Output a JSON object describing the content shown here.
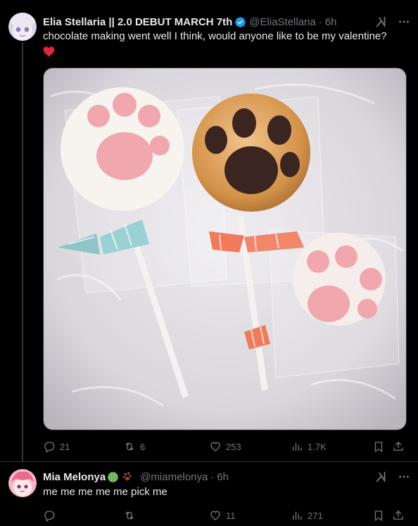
{
  "tweet1": {
    "display_name": "Elia Stellaria || 2.0 DEBUT MARCH 7th",
    "handle": "@EliaStellaria",
    "separator": "·",
    "time": "6h",
    "text": "chocolate making went well I think, would anyone like to be my valentine?",
    "emoji": "heart",
    "stats": {
      "replies": "21",
      "reposts": "6",
      "likes": "253",
      "views": "1.7K"
    }
  },
  "tweet2": {
    "display_name": "Mia Melonya",
    "handle": "@miamelonya",
    "separator": "·",
    "time": "6h",
    "text": "me me me me me pick me",
    "stats": {
      "replies": "",
      "reposts": "",
      "likes": "11",
      "views": "271"
    }
  },
  "icons": [
    "grok-icon",
    "more-icon",
    "reply-icon",
    "repost-icon",
    "like-icon",
    "views-icon",
    "bookmark-icon",
    "share-icon",
    "verified-badge-icon"
  ],
  "colors": {
    "background": "#000000",
    "text": "#e7e9ea",
    "muted": "#71767b",
    "verified": "#1d9bf0",
    "heart": "#f91880"
  }
}
